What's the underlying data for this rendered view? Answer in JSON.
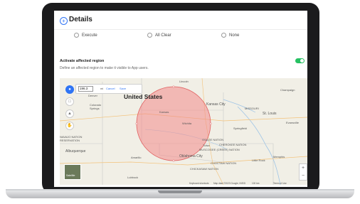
{
  "header": {
    "title": "Details"
  },
  "radios": [
    {
      "label": "Execute"
    },
    {
      "label": "All Clear"
    },
    {
      "label": "None"
    }
  ],
  "region": {
    "title": "Activate affected region",
    "description": "Define an affected region to make it visible to App users.",
    "toggle_on": true
  },
  "radius_editor": {
    "value": "196.3",
    "unit": "mi",
    "cancel": "Cancel",
    "save": "Save"
  },
  "map": {
    "state_label": "United States",
    "places": {
      "lincoln": "Lincoln",
      "denver": "Denver",
      "colorado": "Colorado",
      "springs": "Springs",
      "kansas": "Kansas",
      "kansas_city": "Kansas City",
      "wichita": "Wichita",
      "st_louis": "St. Louis",
      "springfield": "Springfield",
      "evansville": "Evansville",
      "champaign": "Champaign",
      "missouri": "MISSOURI",
      "osage_nation": "OSAGE NATION",
      "cherokee_nation": "CHEROKEE NATION",
      "muscogee": "MUSCOGEE (CREEK) NATION",
      "tulsa": "Tulsa",
      "oklahoma_city": "Oklahoma City",
      "choctaw": "CHOCTAW NATION",
      "chickasaw": "CHICKASAW NATION",
      "little_rock": "Little Rock",
      "memphis": "Memphis",
      "amarillo": "Amarillo",
      "albuquerque": "Albuquerque",
      "lubbock": "Lubbock",
      "navajo": "NAVAJO NATION RESERVATION"
    },
    "satellite_label": "Satellite",
    "attribution": {
      "shortcuts": "Keyboard shortcuts",
      "data": "Map data ©2023 Google, INEGI",
      "scale": "100 km",
      "terms": "Terms of Use"
    },
    "zoom_in": "+",
    "zoom_out": "−"
  },
  "colors": {
    "accent": "#2f74f5",
    "toggle": "#27c163",
    "region_fill": "#f28b8b",
    "region_stroke": "#e06060"
  },
  "icons": [
    "info-circle-icon",
    "pin-icon",
    "square-select-icon",
    "polygon-icon",
    "hand-icon"
  ]
}
